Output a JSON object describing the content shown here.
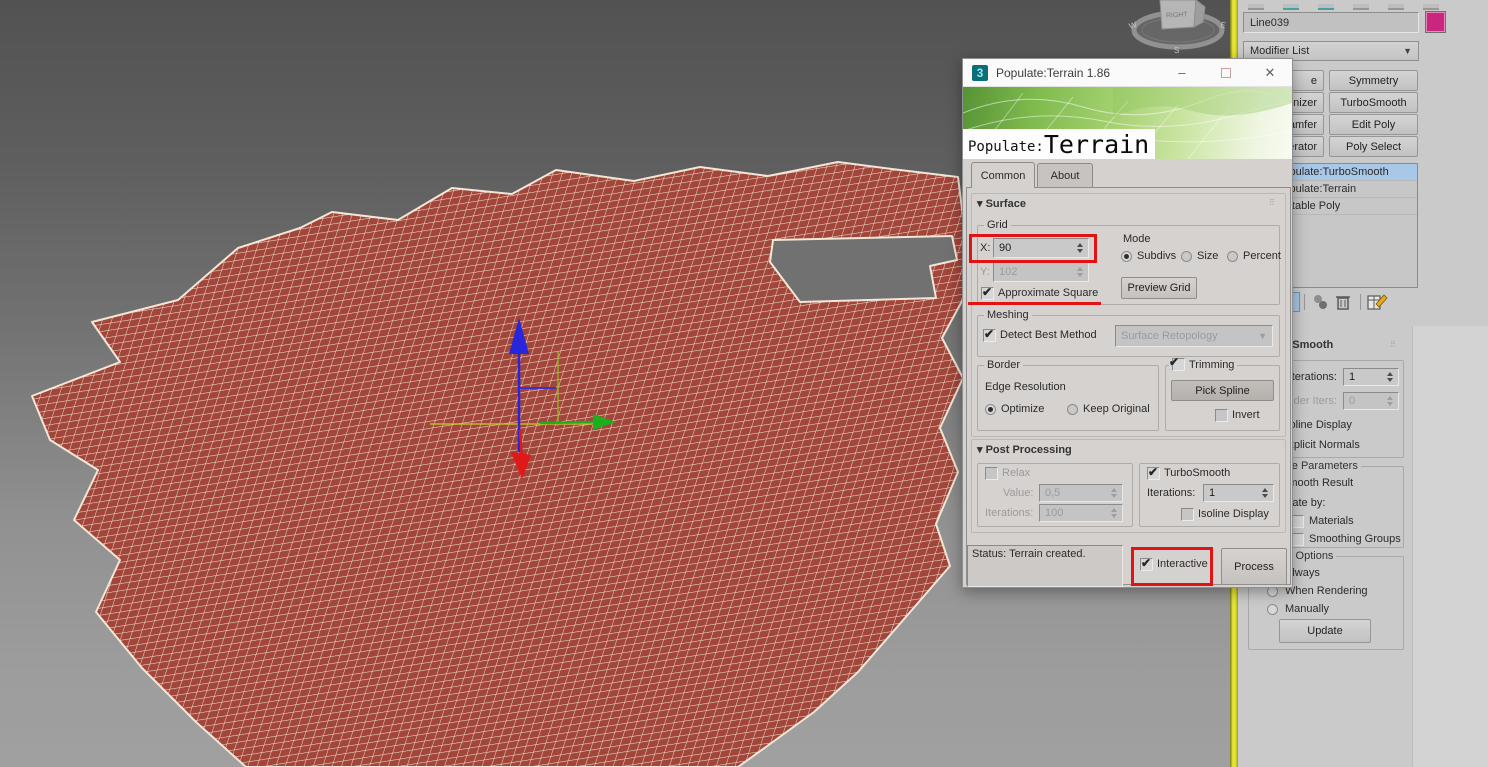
{
  "viewport": {
    "viewcube_face": "RIGHT",
    "compass_w": "W",
    "compass_s": "S",
    "compass_e": "E",
    "terrain_fill": "#a2453a",
    "wire_color": "#f0dfcc",
    "axis_x_color": "#e01818",
    "axis_y_color": "#1cae1c",
    "axis_z_color": "#2626dd",
    "axis_plane_color": "#c8c428"
  },
  "dialog": {
    "title": "Populate:Terrain 1.86",
    "app_icon": "3",
    "minimize": "–",
    "close": "✕",
    "banner_prefix": "Populate:",
    "banner_word": "Terrain",
    "tab_common": "Common",
    "tab_about": "About",
    "surface_header": "Surface",
    "grid_label": "Grid",
    "x_label": "X:",
    "x_value": "90",
    "y_label": "Y:",
    "y_value": "102",
    "approx_square": "Approximate Square",
    "mode_label": "Mode",
    "mode_subdivs": "Subdivs",
    "mode_size": "Size",
    "mode_percent": "Percent",
    "mode_selected": "Subdivs",
    "preview_grid": "Preview Grid",
    "meshing_label": "Meshing",
    "detect_best": "Detect Best Method",
    "retopology": "Surface Retopology",
    "border_label": "Border",
    "edge_resolution": "Edge Resolution",
    "opt_optimize": "Optimize",
    "opt_keep": "Keep Original",
    "edge_selected": "Optimize",
    "trimming": "Trimming",
    "pick_spline": "Pick Spline",
    "invert": "Invert",
    "post_header": "Post Processing",
    "relax": "Relax",
    "relax_value_label": "Value:",
    "relax_value": "0,5",
    "relax_iter_label": "Iterations:",
    "relax_iters": "100",
    "turbo": "TurboSmooth",
    "turbo_iter_label": "Iterations:",
    "turbo_iters": "1",
    "isoline": "Isoline Display",
    "status_text": "Status: Terrain created.",
    "interactive": "Interactive",
    "process": "Process"
  },
  "panel": {
    "object_name": "Line039",
    "wirecolor": "#c9267f",
    "modifier_list": "Modifier List",
    "modifier_buttons_left": [
      "e",
      "nizer",
      "amfer",
      "erator"
    ],
    "modifier_buttons_right": [
      "Symmetry",
      "TurboSmooth",
      "Edit Poly",
      "Poly Select"
    ],
    "stack": [
      {
        "label": "Populate:TurboSmooth",
        "selected": true
      },
      {
        "label": "Populate:Terrain",
        "selected": false
      },
      {
        "label": "Editable Poly",
        "selected": false
      }
    ],
    "ts_header": "TurboSmooth",
    "ts_iter_label": "Iterations:",
    "ts_iters": "1",
    "ts_render_label": "Render Iters:",
    "ts_render_iters": "0",
    "ts_isoline": "Isoline Display",
    "ts_explicit": "Explicit Normals",
    "ts_surface_params": "Surface Parameters",
    "ts_smooth_result": "Smooth Result",
    "ts_separate_by": "Separate by:",
    "ts_materials": "Materials",
    "ts_smoothing_groups": "Smoothing Groups",
    "upd_header": "Update Options",
    "upd_always": "Always",
    "upd_when_rendering": "When Rendering",
    "upd_manually": "Manually",
    "upd_selected": "Always",
    "upd_button": "Update"
  },
  "annotation_color": "#e01414"
}
